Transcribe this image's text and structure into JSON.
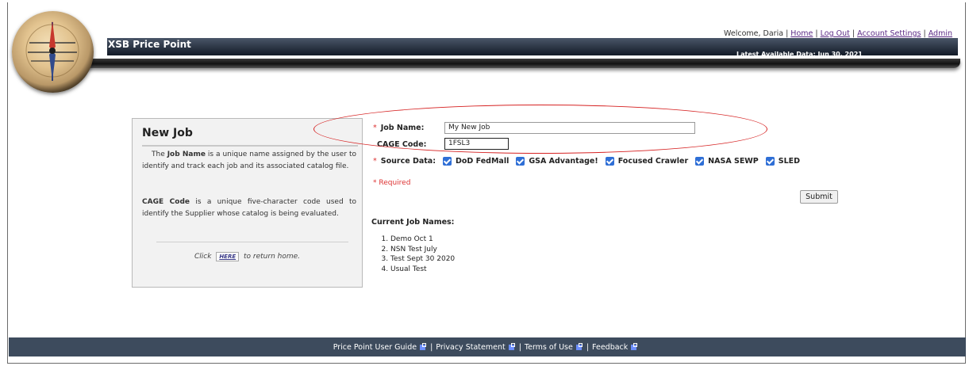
{
  "header": {
    "app_title": "XSB Price Point",
    "latest_data": "Latest Available Data: Jun 30, 2021",
    "welcome": "Welcome, Daria",
    "links": {
      "home": "Home",
      "logout": "Log Out",
      "account_settings": "Account Settings",
      "admin": "Admin"
    },
    "separator": "|"
  },
  "panel": {
    "title": "New Job",
    "p1_before": "The ",
    "p1_bold": "Job Name",
    "p1_after": " is a unique name assigned by the user to identify and track each job and its associated catalog file.",
    "p2_bold": "CAGE Code",
    "p2_after": " is a unique five-character code used to identify the Supplier whose catalog is being evaluated.",
    "click_before": "Click",
    "here_label": "HERE",
    "click_after": "to return home."
  },
  "form": {
    "required_marker": "*",
    "job_name_label": "Job Name:",
    "job_name_value": "My New Job",
    "cage_code_label": "CAGE Code:",
    "cage_code_value": "1FSL3",
    "source_label": "Source Data:",
    "sources": [
      "DoD FedMall",
      "GSA Advantage!",
      "Focused Crawler",
      "NASA SEWP",
      "SLED"
    ],
    "required_note": "* Required",
    "submit_label": "Submit"
  },
  "current_jobs": {
    "title": "Current Job Names:",
    "items": [
      "Demo Oct 1",
      "NSN Test July",
      "Test Sept 30 2020",
      "Usual Test"
    ]
  },
  "footer": {
    "links": [
      "Price Point User Guide",
      "Privacy Statement",
      "Terms of Use",
      "Feedback"
    ],
    "separator": "|"
  },
  "colors": {
    "header_bar": "#1c2431",
    "footer_bar": "#3d4b5d",
    "checkbox": "#2f6fd6",
    "required_red": "#d33333",
    "annotation_oval": "#d62222",
    "link_purple": "#5b2a86"
  },
  "icons": [
    "compass-logo",
    "checkbox-checked-icon",
    "external-link-icon"
  ]
}
